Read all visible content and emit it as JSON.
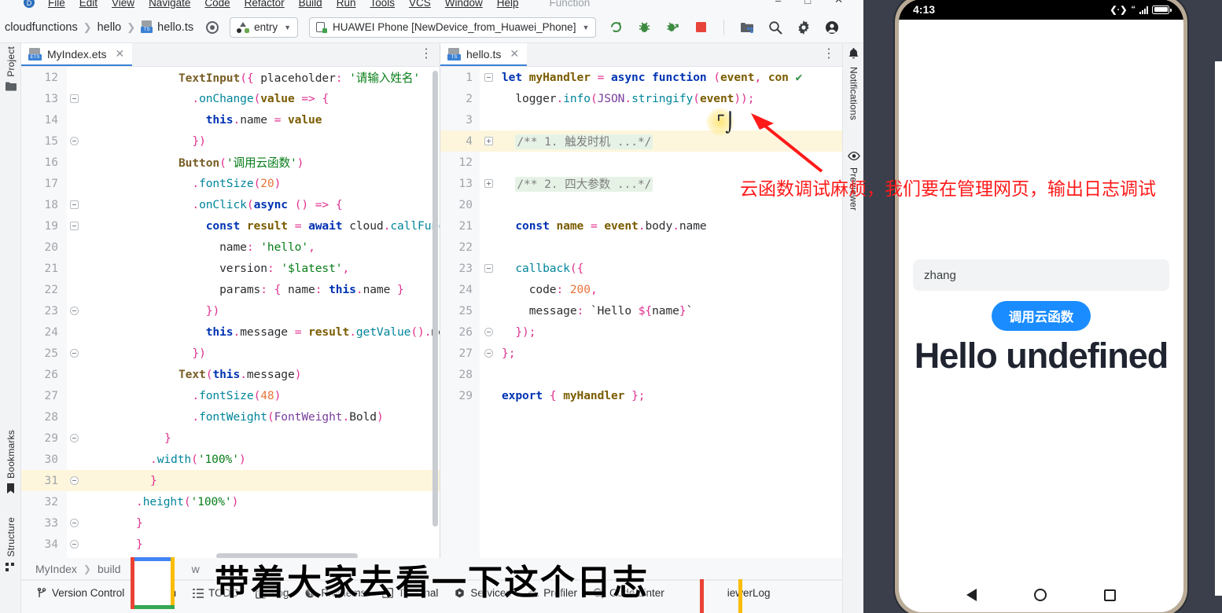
{
  "menu": {
    "logo": "devtools-logo-icon",
    "items": [
      "File",
      "Edit",
      "View",
      "Navigate",
      "Code",
      "Refactor",
      "Build",
      "Run",
      "Tools",
      "VCS",
      "Window",
      "Help"
    ],
    "context": "Function",
    "window_controls": [
      "–",
      "□",
      "✕"
    ]
  },
  "navbar": {
    "breadcrumbs": [
      "cloudfunctions",
      "hello",
      "hello.ts"
    ],
    "run_config": "entry",
    "device": "HUAWEI Phone [NewDevice_from_Huawei_Phone]",
    "icons": [
      "rerun-icon",
      "debug-icon",
      "attach-debugger-icon",
      "stop-icon",
      "project-structure-icon",
      "search-icon",
      "settings-gear-icon",
      "account-icon"
    ]
  },
  "left_sidebar": [
    {
      "label": "Project",
      "icon": "folder-icon"
    },
    {
      "label": "Bookmarks",
      "icon": "bookmark-icon"
    },
    {
      "label": "Structure",
      "icon": "structure-icon"
    }
  ],
  "right_sidebar": [
    {
      "label": "Notifications",
      "icon": "bell-icon"
    },
    {
      "label": "Previewer",
      "icon": "eye-icon"
    }
  ],
  "left_editor": {
    "tab": "MyIndex.ets",
    "tab_badge": "ETS",
    "lines": [
      {
        "n": "12",
        "fold": "",
        "hl": false,
        "html": "<span class=\"fnb\">TextInput</span><span class=\"pun\">(</span><span class=\"pun\">{</span> <span class=\"id\">placeholder</span><span class=\"pun\">:</span> <span class=\"str\">'请输入姓名'</span>   <span class=\"checkmark\">✔</span>",
        "indent": 3
      },
      {
        "n": "13",
        "fold": "minus",
        "hl": false,
        "html": "  <span class=\"pun\">.</span><span class=\"fn\">onChange</span><span class=\"pun\">(</span><span class=\"var\">value</span> <span class=\"pun\">=&gt;</span> <span class=\"pun\">{</span>",
        "indent": 3
      },
      {
        "n": "14",
        "fold": "",
        "hl": false,
        "html": "    <span class=\"kw\">this</span><span class=\"pun\">.</span><span class=\"id\">name</span> <span class=\"pun\">=</span> <span class=\"var\">value</span>",
        "indent": 3
      },
      {
        "n": "15",
        "fold": "round",
        "hl": false,
        "html": "  <span class=\"pun\">}</span><span class=\"pun\">)</span>",
        "indent": 3
      },
      {
        "n": "16",
        "fold": "",
        "hl": false,
        "html": "<span class=\"fnb\">Button</span><span class=\"pun\">(</span><span class=\"str\">'调用云函数'</span><span class=\"pun\">)</span>",
        "indent": 3
      },
      {
        "n": "17",
        "fold": "",
        "hl": false,
        "html": "  <span class=\"pun\">.</span><span class=\"fn\">fontSize</span><span class=\"pun\">(</span><span class=\"num\">20</span><span class=\"pun\">)</span>",
        "indent": 3
      },
      {
        "n": "18",
        "fold": "minus",
        "hl": false,
        "html": "  <span class=\"pun\">.</span><span class=\"fn\">onClick</span><span class=\"pun\">(</span><span class=\"kw\">async</span> <span class=\"pun\">()</span> <span class=\"pun\">=&gt;</span> <span class=\"pun\">{</span>",
        "indent": 3
      },
      {
        "n": "19",
        "fold": "minus",
        "hl": false,
        "html": "    <span class=\"kw\">const</span> <span class=\"var\">result</span> <span class=\"pun\">=</span> <span class=\"kw\">await</span> <span class=\"id\">cloud</span><span class=\"pun\">.</span><span class=\"fn\">callFunc</span>",
        "indent": 3
      },
      {
        "n": "20",
        "fold": "",
        "hl": false,
        "html": "      <span class=\"id\">name</span><span class=\"pun\">:</span> <span class=\"str\">'hello'</span><span class=\"pun\">,</span>",
        "indent": 3
      },
      {
        "n": "21",
        "fold": "",
        "hl": false,
        "html": "      <span class=\"id\">version</span><span class=\"pun\">:</span> <span class=\"str\">'$latest'</span><span class=\"pun\">,</span>",
        "indent": 3
      },
      {
        "n": "22",
        "fold": "",
        "hl": false,
        "html": "      <span class=\"id\">params</span><span class=\"pun\">:</span> <span class=\"pun\">{</span> <span class=\"id\">name</span><span class=\"pun\">:</span> <span class=\"kw\">this</span><span class=\"pun\">.</span><span class=\"id\">name</span> <span class=\"pun\">}</span>",
        "indent": 3
      },
      {
        "n": "23",
        "fold": "round",
        "hl": false,
        "html": "    <span class=\"pun\">}</span><span class=\"pun\">)</span>",
        "indent": 3
      },
      {
        "n": "24",
        "fold": "",
        "hl": false,
        "html": "    <span class=\"kw\">this</span><span class=\"pun\">.</span><span class=\"id\">message</span> <span class=\"pun\">=</span> <span class=\"var\">result</span><span class=\"pun\">.</span><span class=\"fn\">getValue</span><span class=\"pun\">()</span><span class=\"pun\">.</span><span class=\"id\">me</span>",
        "indent": 3
      },
      {
        "n": "25",
        "fold": "round",
        "hl": false,
        "html": "  <span class=\"pun\">}</span><span class=\"pun\">)</span>",
        "indent": 3
      },
      {
        "n": "26",
        "fold": "",
        "hl": false,
        "html": "<span class=\"fnb\">Text</span><span class=\"pun\">(</span><span class=\"kw\">this</span><span class=\"pun\">.</span><span class=\"id\">message</span><span class=\"pun\">)</span>",
        "indent": 3
      },
      {
        "n": "27",
        "fold": "",
        "hl": false,
        "html": "  <span class=\"pun\">.</span><span class=\"fn\">fontSize</span><span class=\"pun\">(</span><span class=\"num\">48</span><span class=\"pun\">)</span>",
        "indent": 3
      },
      {
        "n": "28",
        "fold": "",
        "hl": false,
        "html": "  <span class=\"pun\">.</span><span class=\"fn\">fontWeight</span><span class=\"pun\">(</span><span class=\"tn\">FontWeight</span><span class=\"pun\">.</span><span class=\"id\">Bold</span><span class=\"pun\">)</span>",
        "indent": 3
      },
      {
        "n": "29",
        "fold": "round",
        "hl": false,
        "html": "<span class=\"pun\">}</span>",
        "indent": 2
      },
      {
        "n": "30",
        "fold": "",
        "hl": false,
        "html": "<span class=\"pun\">.</span><span class=\"fn\">width</span><span class=\"pun\">(</span><span class=\"str\">'100%'</span><span class=\"pun\">)</span>",
        "indent": 1
      },
      {
        "n": "31",
        "fold": "round",
        "hl": true,
        "html": "<span class=\"pun\">}</span>",
        "indent": 1
      },
      {
        "n": "32",
        "fold": "",
        "hl": false,
        "html": "<span class=\"pun\">.</span><span class=\"fn\">height</span><span class=\"pun\">(</span><span class=\"str\">'100%'</span><span class=\"pun\">)</span>",
        "indent": 0
      },
      {
        "n": "33",
        "fold": "round",
        "hl": false,
        "html": "<span class=\"pun\">}</span>",
        "indent": 0
      },
      {
        "n": "34",
        "fold": "round",
        "hl": false,
        "html": "<span class=\"pun\">}</span>",
        "indent": -1
      }
    ]
  },
  "right_editor": {
    "tab": "hello.ts",
    "tab_badge": "TS",
    "lines": [
      {
        "n": "1",
        "fold": "minus",
        "hl": false,
        "html": "<span class=\"kw\">let</span> <span class=\"var\">myHandler</span> <span class=\"pun\">=</span> <span class=\"kw\">async</span> <span class=\"kw\">function</span> <span class=\"pun\">(</span><span class=\"var\">event</span><span class=\"pun\">,</span> <span class=\"var\">con</span> <span class=\"checkmark\">✔</span>",
        "indent": 0
      },
      {
        "n": "2",
        "fold": "",
        "hl": false,
        "html": "  <span class=\"id\">logger</span><span class=\"pun\">.</span><span class=\"fn\">info</span><span class=\"pun\">(</span><span class=\"tn\">JSON</span><span class=\"pun\">.</span><span class=\"fn\">stringify</span><span class=\"pun\">(</span><span class=\"var\">event</span><span class=\"pun\">))</span><span class=\"pun\">;</span>",
        "indent": 0
      },
      {
        "n": "3",
        "fold": "",
        "hl": false,
        "html": "",
        "indent": 0
      },
      {
        "n": "4",
        "fold": "plus",
        "hl": true,
        "html": "  <span class=\"folded-cmt\">/** 1. 触发时机 ...*/</span>",
        "indent": 0
      },
      {
        "n": "12",
        "fold": "",
        "hl": false,
        "html": "",
        "indent": 0
      },
      {
        "n": "13",
        "fold": "plus",
        "hl": false,
        "html": "  <span class=\"folded-cmt\">/** 2. 四大参数 ...*/</span>",
        "indent": 0
      },
      {
        "n": "20",
        "fold": "",
        "hl": false,
        "html": "",
        "indent": 0
      },
      {
        "n": "21",
        "fold": "",
        "hl": false,
        "html": "  <span class=\"kw\">const</span> <span class=\"var\">name</span> <span class=\"pun\">=</span> <span class=\"var\">event</span><span class=\"pun\">.</span><span class=\"id\">body</span><span class=\"pun\">.</span><span class=\"id\">name</span>",
        "indent": 0
      },
      {
        "n": "22",
        "fold": "",
        "hl": false,
        "html": "",
        "indent": 0
      },
      {
        "n": "23",
        "fold": "minus",
        "hl": false,
        "html": "  <span class=\"fn\">callback</span><span class=\"pun\">(</span><span class=\"pun\">{</span>",
        "indent": 0
      },
      {
        "n": "24",
        "fold": "",
        "hl": false,
        "html": "    <span class=\"id\">code</span><span class=\"pun\">:</span> <span class=\"num\">200</span><span class=\"pun\">,</span>",
        "indent": 0
      },
      {
        "n": "25",
        "fold": "",
        "hl": false,
        "html": "    <span class=\"id\">message</span><span class=\"pun\">:</span> <span class=\"tmpl\">`Hello </span><span class=\"pun\">${</span><span class=\"id\">name</span><span class=\"pun\">}</span><span class=\"tmpl\">`</span>",
        "indent": 0
      },
      {
        "n": "26",
        "fold": "round",
        "hl": false,
        "html": "  <span class=\"pun\">})</span><span class=\"pun\">;</span>",
        "indent": 0
      },
      {
        "n": "27",
        "fold": "round",
        "hl": false,
        "html": "<span class=\"pun\">}</span><span class=\"pun\">;</span>",
        "indent": 0
      },
      {
        "n": "28",
        "fold": "",
        "hl": false,
        "html": "",
        "indent": 0
      },
      {
        "n": "29",
        "fold": "",
        "hl": false,
        "html": "<span class=\"kw\">export</span> <span class=\"pun\">{</span> <span class=\"var\">myHandler</span> <span class=\"pun\">}</span><span class=\"pun\">;</span>",
        "indent": 0
      }
    ]
  },
  "bottom": {
    "breadcrumbs": [
      "MyIndex",
      "build",
      "w"
    ],
    "tool_windows": [
      {
        "label": "Version Control",
        "icon": "branch-icon"
      },
      {
        "label": "Run",
        "icon": "run-icon"
      },
      {
        "label": "TODO",
        "icon": "list-icon"
      },
      {
        "label": "Log",
        "icon": "log-icon"
      },
      {
        "label": "Problems",
        "icon": "warning-icon"
      },
      {
        "label": "Terminal",
        "icon": "terminal-icon"
      },
      {
        "label": "Services",
        "icon": "services-icon"
      },
      {
        "label": "Profiler",
        "icon": "profiler-icon"
      },
      {
        "label": "Code Linter",
        "icon": "linter-icon"
      },
      {
        "label": "iewerLog",
        "icon": "previewer-log-icon"
      }
    ]
  },
  "phone": {
    "status_time": "4:13",
    "status_icons": [
      "network-icon",
      "signal-icon",
      "battery-icon"
    ],
    "input_value": "zhang",
    "button_label": "调用云函数",
    "message": "Hello undefined",
    "nav": [
      "back-icon",
      "home-icon",
      "recents-icon"
    ]
  },
  "overlays": {
    "red_annotation": "云函数调试麻烦，我们要在管理网页，输出日志调试",
    "subtitle": "带着大家去看一下这个日志",
    "cursor": "text-cursor-icon",
    "accent_red": "#ff1a1a",
    "accent_blue": "#1a8cff"
  }
}
